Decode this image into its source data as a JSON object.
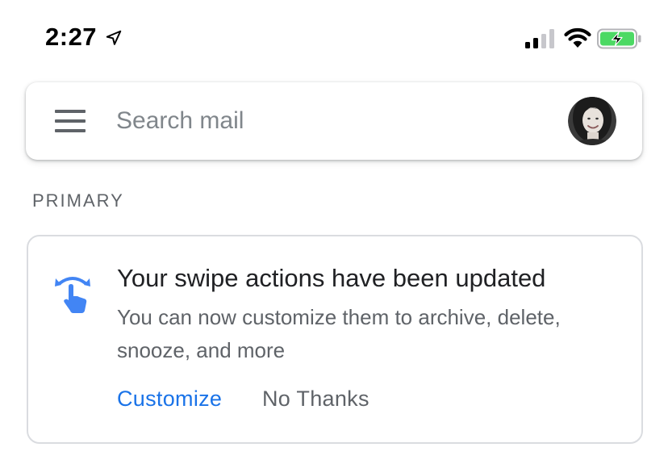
{
  "status_bar": {
    "time": "2:27",
    "icons": [
      "location-arrow-icon",
      "cellular-signal-icon",
      "wifi-icon",
      "battery-charging-icon"
    ]
  },
  "search": {
    "placeholder": "Search mail",
    "value": "",
    "menu_icon": "hamburger-menu-icon",
    "avatar_icon": "account-avatar"
  },
  "section": {
    "label": "PRIMARY"
  },
  "card": {
    "icon": "swipe-gesture-icon",
    "title": "Your swipe actions have been updated",
    "body": "You can now customize them to archive, delete, snooze, and more",
    "primary_action": "Customize",
    "secondary_action": "No Thanks"
  },
  "colors": {
    "accent_blue": "#1a73e8",
    "icon_blue": "#4285f4",
    "text_primary": "#202124",
    "text_secondary": "#5f6368",
    "battery_green": "#4cd964"
  }
}
